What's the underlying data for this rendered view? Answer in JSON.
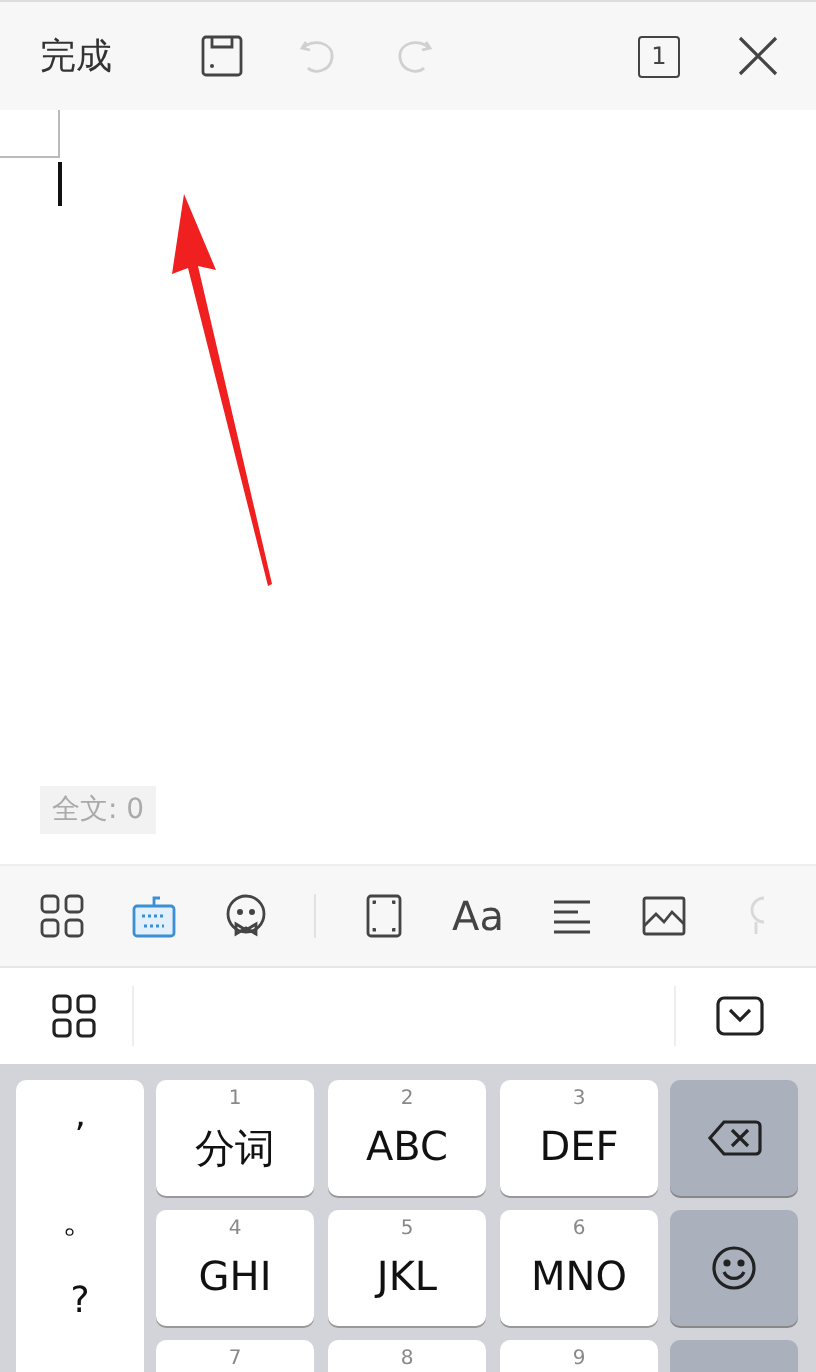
{
  "top_bar": {
    "done": "完成",
    "undo_disabled": true,
    "redo_disabled": true,
    "page_count": "1"
  },
  "editor": {
    "word_count": "全文: 0"
  },
  "toolbar": {
    "items": [
      {
        "kind": "grid",
        "selected": false
      },
      {
        "kind": "keyboard",
        "selected": true
      },
      {
        "kind": "emoji",
        "selected": false
      },
      {
        "kind": "frame",
        "selected": false
      },
      {
        "kind": "font",
        "selected": false,
        "label": "Aa"
      },
      {
        "kind": "align",
        "selected": false
      },
      {
        "kind": "image",
        "selected": false
      },
      {
        "kind": "mic",
        "selected": false
      }
    ]
  },
  "keyboard": {
    "punctuation": [
      "’",
      "。",
      "?"
    ],
    "keys": [
      {
        "digit": "1",
        "label": "分词"
      },
      {
        "digit": "2",
        "label": "ABC"
      },
      {
        "digit": "3",
        "label": "DEF"
      },
      {
        "digit": "4",
        "label": "GHI"
      },
      {
        "digit": "5",
        "label": "JKL"
      },
      {
        "digit": "6",
        "label": "MNO"
      },
      {
        "digit": "7"
      },
      {
        "digit": "8"
      },
      {
        "digit": "9"
      }
    ],
    "side_keys": [
      {
        "kind": "backspace"
      },
      {
        "kind": "emoji"
      },
      {
        "kind": "blank"
      }
    ]
  }
}
